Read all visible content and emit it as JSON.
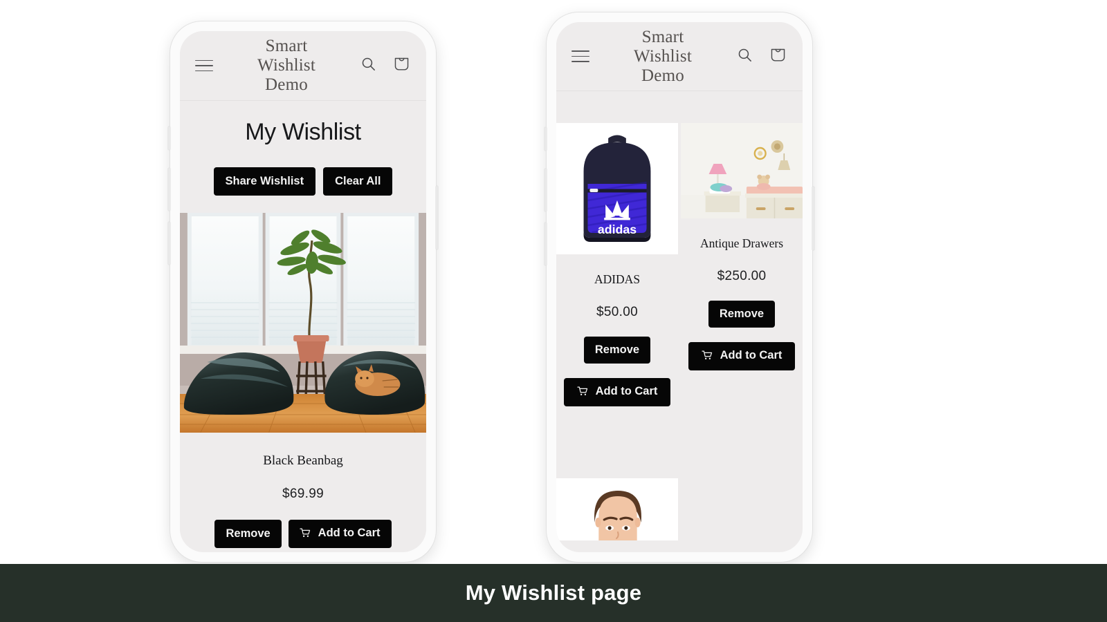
{
  "caption": {
    "text": "My Wishlist page"
  },
  "colors": {
    "caption_bar": "#263029",
    "button_dark": "#060606",
    "screen_bg": "#eeecec",
    "phone_frame": "#fbfbfb",
    "title_text": "#55514f"
  },
  "store_header": {
    "title": "Smart\nWishlist\nDemo",
    "menu_icon": "hamburger-menu-icon",
    "search_icon": "search-icon",
    "cart_icon": "shopping-bag-icon"
  },
  "phone_left": {
    "page_title": "My Wishlist",
    "actions": [
      {
        "label": "Share Wishlist",
        "name": "share-wishlist-button"
      },
      {
        "label": "Clear All",
        "name": "clear-all-button"
      }
    ],
    "product": {
      "name": "Black Beanbag",
      "price": "$69.99",
      "image_alt": "Living room with two dark beanbags, potted plant and a cat by the windows",
      "remove_label": "Remove",
      "add_to_cart_label": "Add to Cart"
    }
  },
  "phone_right": {
    "products": [
      {
        "name": "ADIDAS",
        "price": "$50.00",
        "image_alt": "Blue and navy adidas backpack",
        "remove_label": "Remove",
        "add_to_cart_label": "Add to Cart"
      },
      {
        "name": "Antique Drawers",
        "price": "$250.00",
        "image_alt": "Nursery room with antique changing table drawers and pink lamp",
        "remove_label": "Remove",
        "add_to_cart_label": "Add to Cart"
      }
    ],
    "partial_product": {
      "image_alt": "Portrait of a man, partially visible product photo"
    }
  }
}
